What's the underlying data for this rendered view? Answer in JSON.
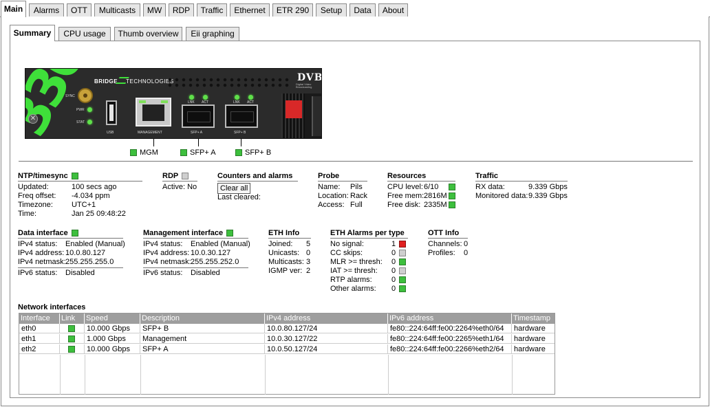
{
  "tabs": [
    "Main",
    "Alarms",
    "OTT",
    "Multicasts",
    "MW",
    "RDP",
    "Traffic",
    "Ethernet",
    "ETR 290",
    "Setup",
    "Data",
    "About"
  ],
  "sub_tabs": [
    "Summary",
    "CPU usage",
    "Thumb overview",
    "Eii graphing"
  ],
  "device": {
    "model": "330",
    "brand": "BRIDGE",
    "brand2": "TECHNOLOGIES",
    "dvb": "DVB",
    "dvb_sub": "Digital Video Broadcasting",
    "leds": [
      "SYNC",
      "PWR",
      "STAT"
    ],
    "ports": [
      "USB",
      "MANAGEMENT",
      "SFP+ A",
      "SFP+ B"
    ],
    "sfp_leds": [
      "LNK",
      "ACT"
    ]
  },
  "port_status": [
    {
      "label": "MGM",
      "status": "green"
    },
    {
      "label": "SFP+ A",
      "status": "green"
    },
    {
      "label": "SFP+ B",
      "status": "green"
    }
  ],
  "ntp": {
    "title": "NTP/timesync",
    "status": "green",
    "rows": [
      [
        "Updated:",
        "100 secs ago"
      ],
      [
        "Freq offset:",
        "-4.034 ppm"
      ],
      [
        "Timezone:",
        "UTC+1"
      ],
      [
        "Time:",
        "Jan 25 09:48:22"
      ]
    ]
  },
  "rdp": {
    "title": "RDP",
    "status": "gray",
    "active_label": "Active:",
    "active_value": "No"
  },
  "counters": {
    "title": "Counters and alarms",
    "clear_button": "Clear all",
    "last_cleared": "Last cleared:"
  },
  "probe": {
    "title": "Probe",
    "rows": [
      [
        "Name:",
        "Pils"
      ],
      [
        "Location:",
        "Rack"
      ],
      [
        "Access:",
        "Full"
      ]
    ]
  },
  "resources": {
    "title": "Resources",
    "rows": [
      [
        "CPU level:",
        "6/10",
        "green"
      ],
      [
        "Free mem:",
        "2816M",
        "green"
      ],
      [
        "Free disk:",
        "2335M",
        "green"
      ]
    ]
  },
  "traffic": {
    "title": "Traffic",
    "rows": [
      [
        "RX data:",
        "9.339 Gbps"
      ],
      [
        "Monitored data:",
        "9.339 Gbps"
      ]
    ]
  },
  "data_if": {
    "title": "Data interface",
    "status": "green",
    "rows": [
      [
        "IPv4 status:",
        "Enabled (Manual)"
      ],
      [
        "IPv4 address:",
        "10.0.80.127"
      ],
      [
        "IPv4 netmask:",
        "255.255.255.0"
      ]
    ],
    "ipv6": [
      "IPv6 status:",
      "Disabled"
    ]
  },
  "mgmt_if": {
    "title": "Management interface",
    "status": "green",
    "rows": [
      [
        "IPv4 status:",
        "Enabled (Manual)"
      ],
      [
        "IPv4 address:",
        "10.0.30.127"
      ],
      [
        "IPv4 netmask:",
        "255.255.252.0"
      ]
    ],
    "ipv6": [
      "IPv6 status:",
      "Disabled"
    ]
  },
  "eth_info": {
    "title": "ETH Info",
    "rows": [
      [
        "Joined:",
        "5"
      ],
      [
        "Unicasts:",
        "0"
      ],
      [
        "Multicasts:",
        "3"
      ],
      [
        "IGMP ver:",
        "2"
      ]
    ]
  },
  "eth_alarms": {
    "title": "ETH Alarms per type",
    "rows": [
      [
        "No signal:",
        "1",
        "red"
      ],
      [
        "CC skips:",
        "0",
        "gray"
      ],
      [
        "MLR >= thresh:",
        "0",
        "green"
      ],
      [
        "IAT >= thresh:",
        "0",
        "gray"
      ],
      [
        "RTP alarms:",
        "0",
        "green"
      ],
      [
        "Other alarms:",
        "0",
        "green"
      ]
    ]
  },
  "ott_info": {
    "title": "OTT Info",
    "rows": [
      [
        "Channels:",
        "0"
      ],
      [
        "Profiles:",
        "0"
      ]
    ]
  },
  "network": {
    "title": "Network interfaces",
    "columns": [
      "Interface",
      "Link",
      "Speed",
      "Description",
      "IPv4 address",
      "IPv6 address",
      "Timestamp"
    ],
    "rows": [
      [
        "eth0",
        "green",
        "10.000 Gbps",
        "SFP+ B",
        "10.0.80.127/24",
        "fe80::224:64ff:fe00:2264%eth0/64",
        "hardware"
      ],
      [
        "eth1",
        "green",
        "1.000 Gbps",
        "Management",
        "10.0.30.127/22",
        "fe80::224:64ff:fe00:2265%eth1/64",
        "hardware"
      ],
      [
        "eth2",
        "green",
        "10.000 Gbps",
        "SFP+ A",
        "10.0.50.127/24",
        "fe80::224:64ff:fe00:2266%eth2/64",
        "hardware"
      ]
    ]
  }
}
